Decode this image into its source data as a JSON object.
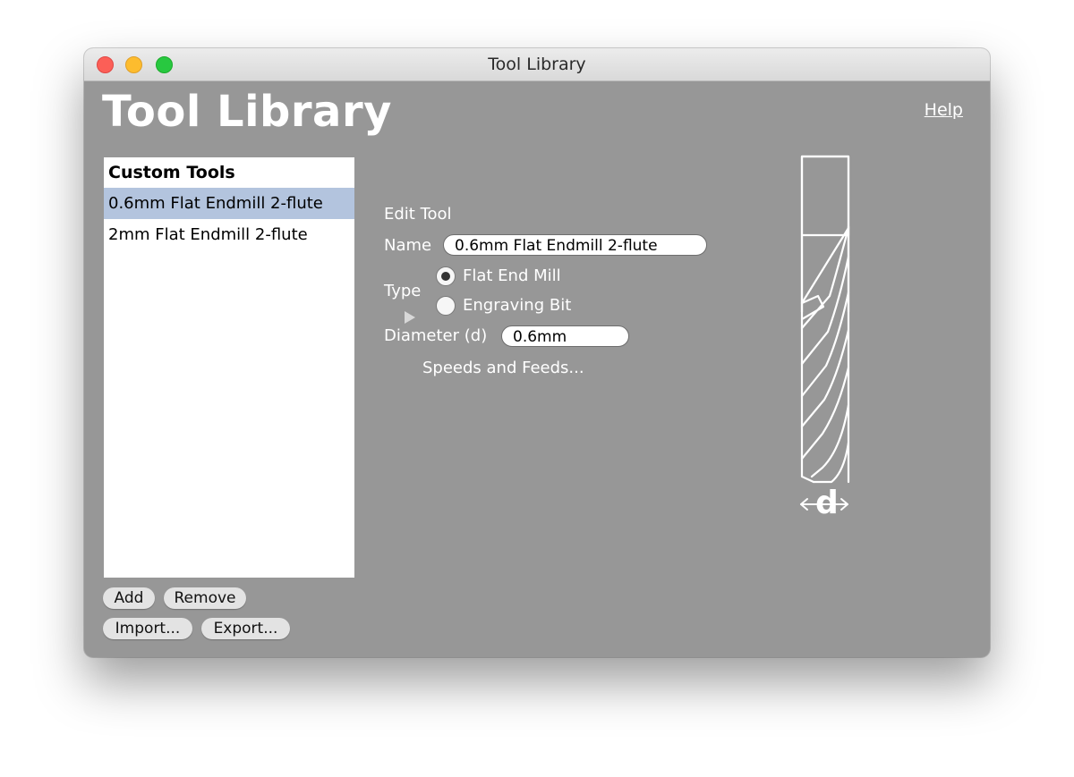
{
  "window": {
    "title": "Tool Library"
  },
  "header": {
    "title": "Tool Library",
    "help_label": "Help"
  },
  "tool_list": {
    "header": "Custom Tools",
    "items": [
      {
        "label": "0.6mm Flat Endmill 2-flute",
        "selected": true
      },
      {
        "label": "2mm Flat Endmill 2-flute",
        "selected": false
      }
    ]
  },
  "buttons": {
    "add": "Add",
    "remove": "Remove",
    "import": "Import...",
    "export": "Export..."
  },
  "edit_tool": {
    "section_title": "Edit Tool",
    "name_label": "Name",
    "name_value": "0.6mm Flat Endmill 2-flute",
    "type_label": "Type",
    "type_options": [
      {
        "label": "Flat End Mill",
        "selected": true
      },
      {
        "label": "Engraving Bit",
        "selected": false
      }
    ],
    "diameter_label": "Diameter (d)",
    "diameter_value": "0.6mm",
    "speeds_label": "Speeds and Feeds..."
  },
  "illustration": {
    "dimension_label": "d"
  },
  "icons": [
    "close-light",
    "minimize-light",
    "zoom-light",
    "disclosure-triangle-icon",
    "endmill-icon",
    "double-arrow-icon"
  ]
}
